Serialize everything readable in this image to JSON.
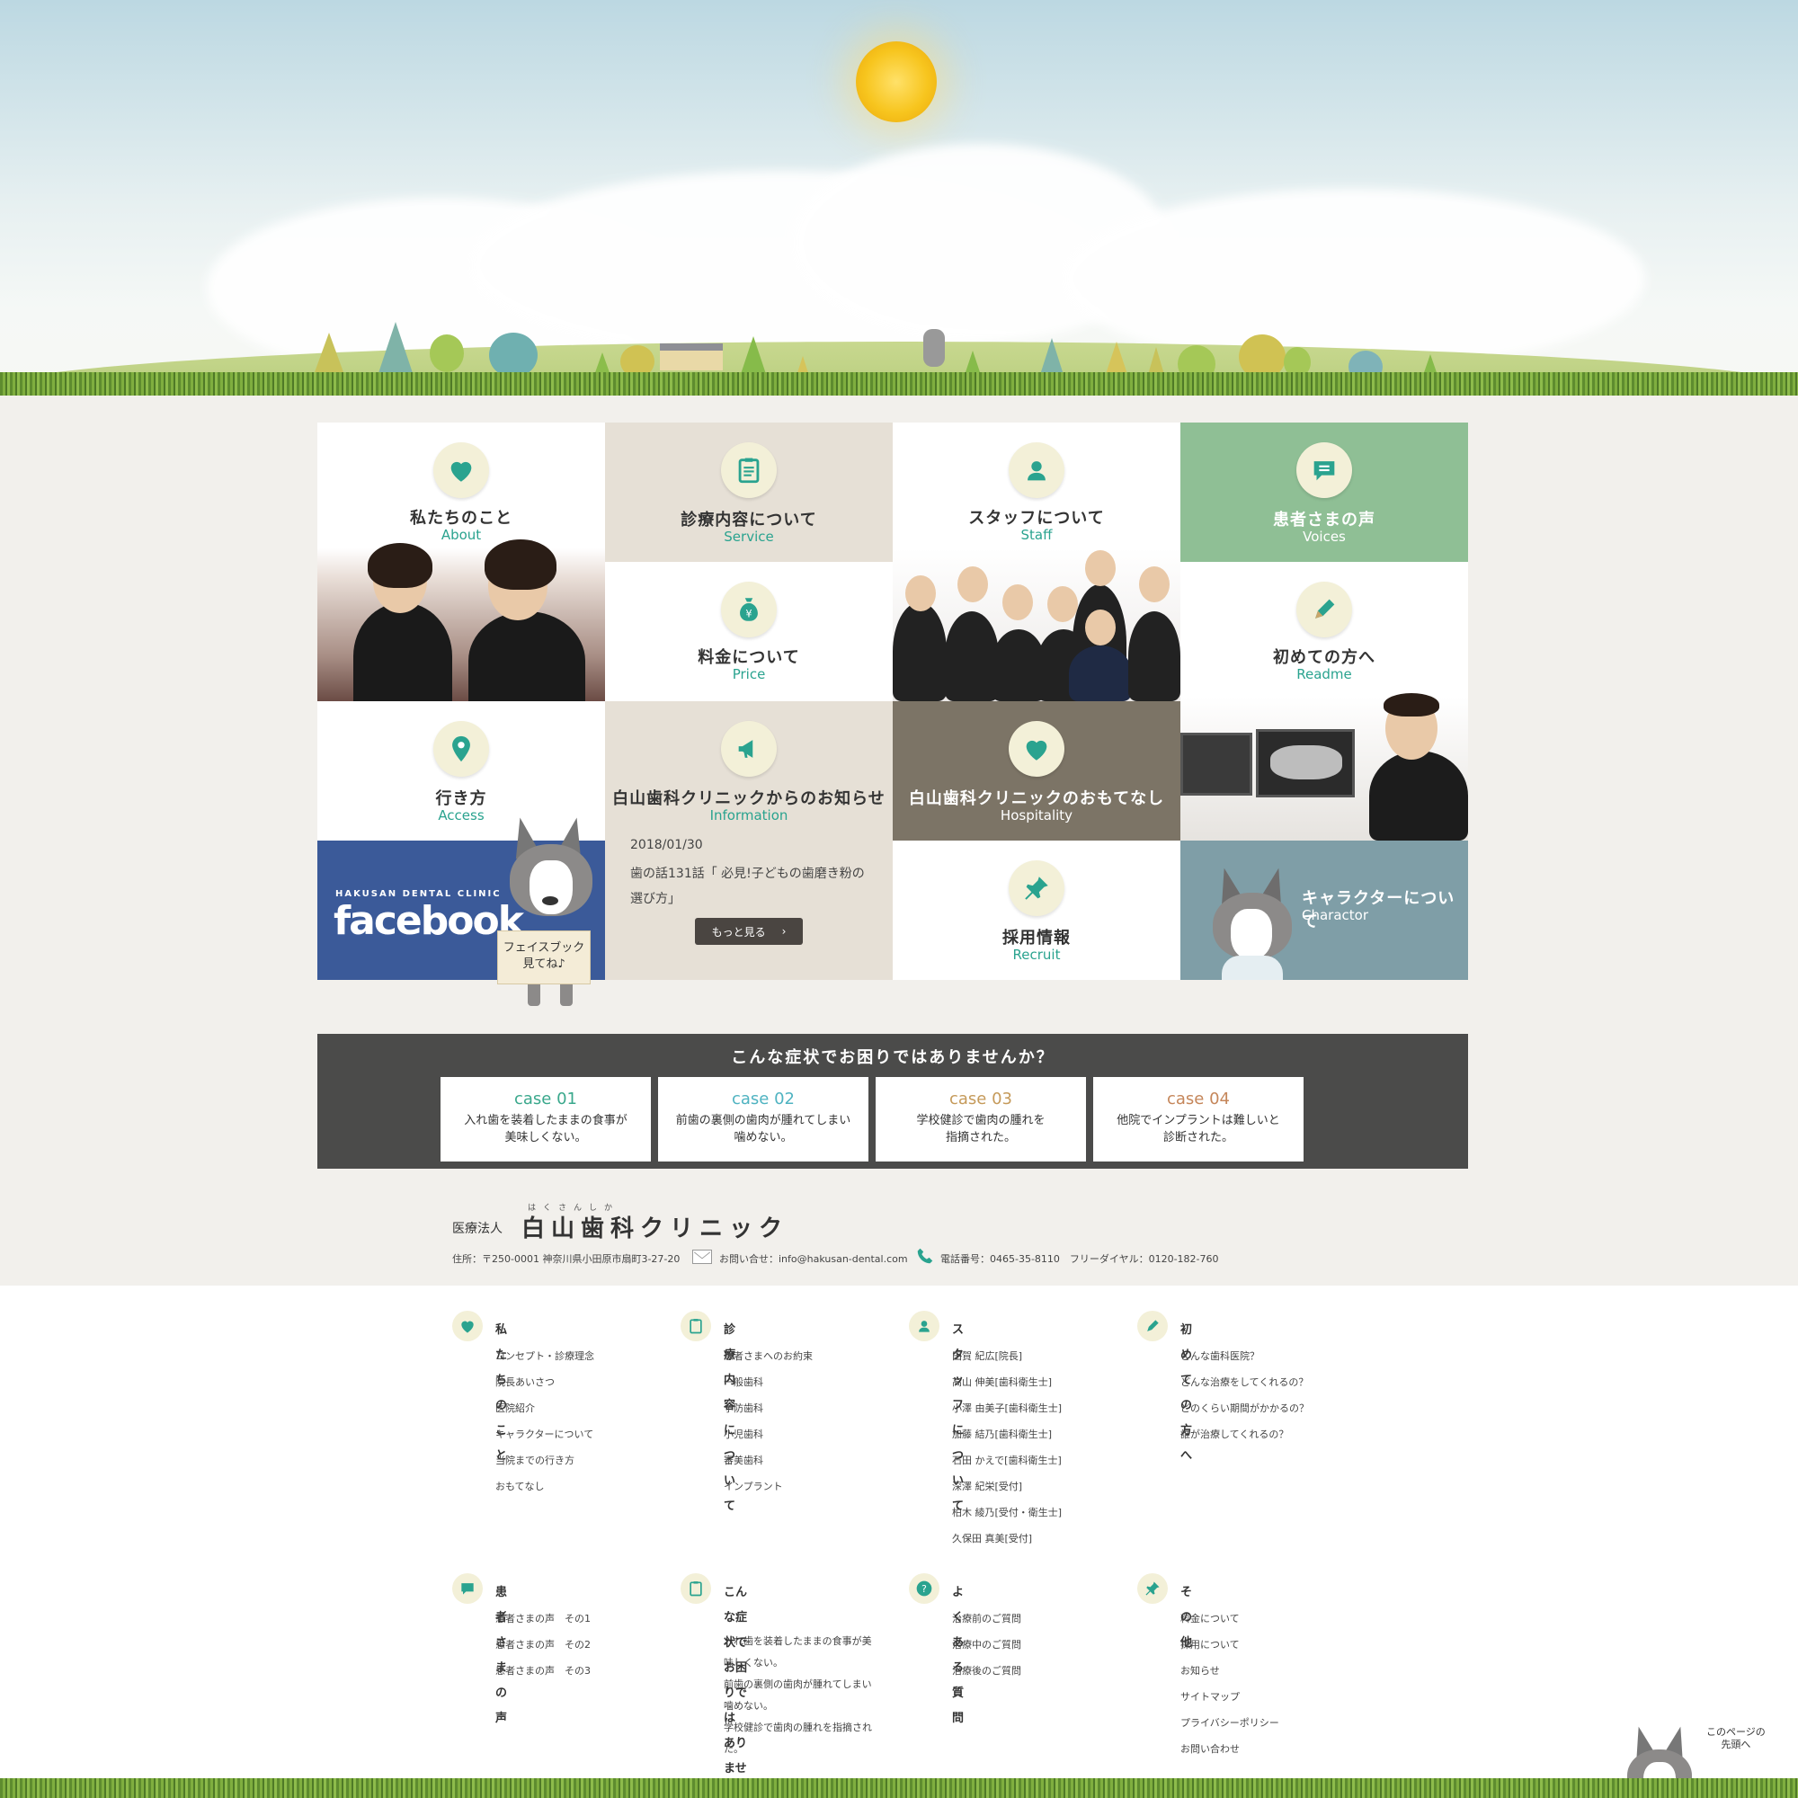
{
  "tiles": {
    "about": {
      "title": "私たちのこと",
      "sub": "About"
    },
    "service": {
      "title": "診療内容について",
      "sub": "Service"
    },
    "staff": {
      "title": "スタッフについて",
      "sub": "Staff"
    },
    "voices": {
      "title": "患者さまの声",
      "sub": "Voices"
    },
    "price": {
      "title": "料金について",
      "sub": "Price"
    },
    "readme": {
      "title": "初めての方へ",
      "sub": "Readme"
    },
    "access": {
      "title": "行き方",
      "sub": "Access"
    },
    "information": {
      "title": "白山歯科クリニックからのお知らせ",
      "sub": "Information"
    },
    "hospitality": {
      "title": "白山歯科クリニックのおもてなし",
      "sub": "Hospitality"
    },
    "recruit": {
      "title": "採用情報",
      "sub": "Recruit"
    },
    "charactor": {
      "title": "キャラクターについて",
      "sub": "Charactor"
    }
  },
  "news": {
    "date": "2018/01/30",
    "text": "歯の話131話「 必見!子どもの歯磨き粉の選び方」",
    "more_label": "もっと見る",
    "more_arrow": "›"
  },
  "facebook": {
    "small": "HAKUSAN DENTAL CLINIC",
    "big": "facebook",
    "sign_line1": "フェイスブック",
    "sign_line2": "見てね♪"
  },
  "symptoms": {
    "title": "こんな症状でお困りではありませんか？",
    "cases": [
      {
        "label": "case",
        "num": "01",
        "line1": "入れ歯を装着したままの食事が",
        "line2": "美味しくない。",
        "color": "#3aa88c"
      },
      {
        "label": "case",
        "num": "02",
        "line1": "前歯の裏側の歯肉が腫れてしまい",
        "line2": "噛めない。",
        "color": "#4fb3c1"
      },
      {
        "label": "case",
        "num": "03",
        "line1": "学校健診で歯肉の腫れを",
        "line2": "指摘された。",
        "color": "#c59a5a"
      },
      {
        "label": "case",
        "num": "04",
        "line1": "他院でインプラントは難しいと",
        "line2": "診断された。",
        "color": "#c5865a"
      }
    ]
  },
  "clinic": {
    "prefix": "医療法人",
    "ruby": "はくさんしか",
    "name": "白山歯科クリニック",
    "address": "住所：〒250-0001 神奈川県小田原市扇町3-27-20",
    "email": "お問い合せ：info@hakusan-dental.com",
    "phone": "電話番号：0465-35-8110　フリーダイヤル：0120-182-760"
  },
  "footer": {
    "col1": {
      "head": "私たちのこと",
      "items": [
        "コンセプト・診療理念",
        "院長あいさつ",
        "医院紹介",
        "キャラクターについて",
        "当院までの行き方",
        "おもてなし"
      ]
    },
    "col2": {
      "head": "診療内容について",
      "items": [
        "患者さまへのお約束",
        "一般歯科",
        "予防歯科",
        "小児歯科",
        "審美歯科",
        "インプラント"
      ]
    },
    "col3": {
      "head": "スタッフについて",
      "items": [
        "田賀 紀広[院長]",
        "高山 伸美[歯科衛生士]",
        "小澤 由美子[歯科衛生士]",
        "加藤 結乃[歯科衛生士]",
        "石田 かえで[歯科衛生士]",
        "深澤 紀栄[受付]",
        "柏木 綾乃[受付・衛生士]",
        "久保田 真美[受付]"
      ]
    },
    "col4": {
      "head": "初めての方へ",
      "items": [
        "どんな歯科医院？",
        "どんな治療をしてくれるの？",
        "どのくらい期間がかかるの？",
        "誰が治療してくれるの？"
      ]
    },
    "col5": {
      "head": "患者さまの声",
      "items": [
        "患者さまの声　その1",
        "患者さまの声　その2",
        "患者さまの声　その3"
      ]
    },
    "col6": {
      "head_line1": "こんな症状でお困りでは",
      "head_line2": "ありませんか？",
      "items": [
        "入れ歯を装着したままの食事が美味しくない。",
        "前歯の裏側の歯肉が腫れてしまい噛めない。",
        "学校健診で歯肉の腫れを指摘された。"
      ]
    },
    "col7": {
      "head": "よくある質問",
      "items": [
        "治療前のご質問",
        "治療中のご質問",
        "治療後のご質問"
      ]
    },
    "col8": {
      "head": "その他",
      "items": [
        "料金について",
        "採用について",
        "お知らせ",
        "サイトマップ",
        "プライバシーポリシー",
        "お問い合わせ"
      ]
    }
  },
  "to_top": {
    "line1": "このページの",
    "line2": "先頭へ"
  },
  "colors": {
    "accent": "#2aa38f",
    "beige": "#e6e0d6",
    "mint": "#8fbf95",
    "taupe": "#7c7466",
    "slate": "#7f9ea7",
    "fb": "#3b5a99",
    "dark": "#4b4b4a"
  },
  "icons": [
    "heart-icon",
    "clipboard-icon",
    "person-icon",
    "speech-bubble-icon",
    "yen-bag-icon",
    "pencil-icon",
    "map-pin-icon",
    "megaphone-icon",
    "push-pin-icon",
    "question-icon",
    "mail-icon",
    "phone-icon"
  ]
}
